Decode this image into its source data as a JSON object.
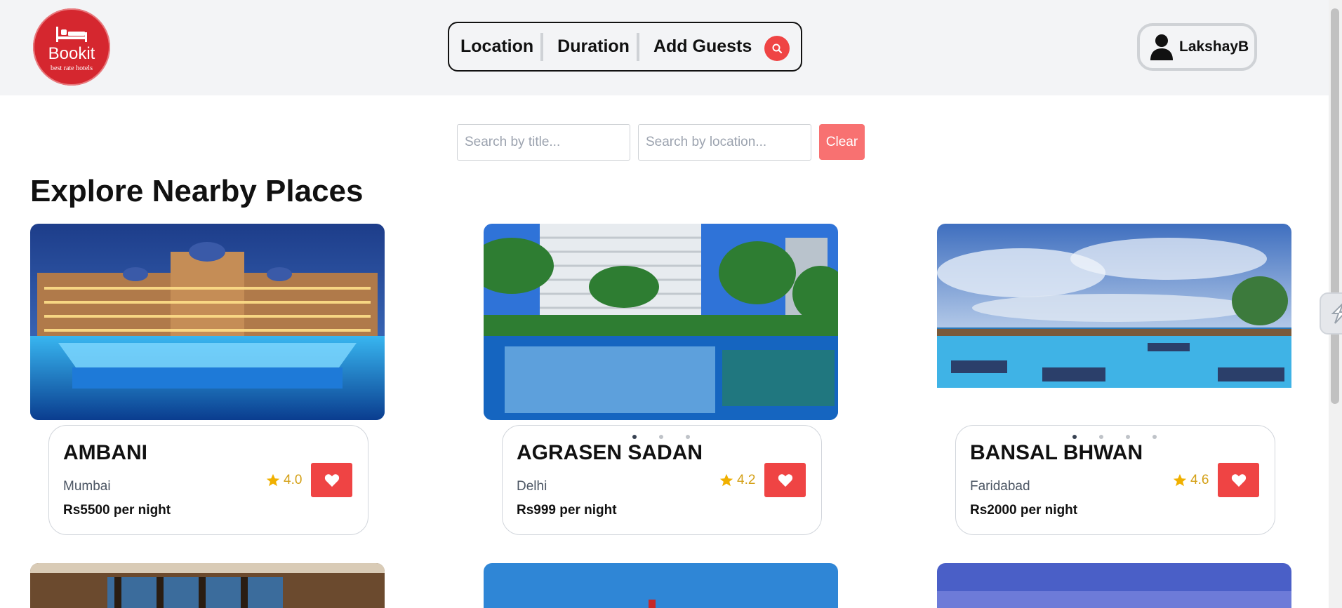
{
  "logo": {
    "name": "Bookit",
    "tagline": "best rate hotels",
    "icon": "bed-icon",
    "color": "#d5272f"
  },
  "searchbar": {
    "segments": [
      "Location",
      "Duration",
      "Add Guests"
    ],
    "search_icon": "search-icon"
  },
  "user": {
    "name": "LakshayB",
    "icon": "user-icon"
  },
  "filters": {
    "title_placeholder": "Search by title...",
    "location_placeholder": "Search by location...",
    "clear_label": "Clear"
  },
  "section_title": "Explore Nearby Places",
  "places": [
    {
      "title": "AMBANI",
      "location": "Mumbai",
      "rating": "4.0",
      "price": "Rs5500 per night",
      "dots": 0,
      "active_dot": -1
    },
    {
      "title": "AGRASEN SADAN",
      "location": "Delhi",
      "rating": "4.2",
      "price": "Rs999 per night",
      "dots": 3,
      "active_dot": 0
    },
    {
      "title": "BANSAL BHWAN",
      "location": "Faridabad",
      "rating": "4.6",
      "price": "Rs2000 per night",
      "dots": 4,
      "active_dot": 0
    }
  ],
  "colors": {
    "accent": "#ef4444",
    "star": "#f0b000",
    "header_bg": "#f3f4f6"
  }
}
